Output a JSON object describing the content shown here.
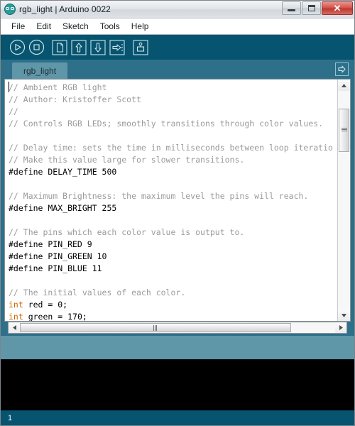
{
  "window": {
    "title": "rgb_light | Arduino 0022",
    "app_icon": "arduino-infinity-icon",
    "controls": {
      "minimize": "minimize-button",
      "maximize": "maximize-button",
      "close_glyph": "✕"
    }
  },
  "menubar": {
    "items": [
      {
        "label": "File"
      },
      {
        "label": "Edit"
      },
      {
        "label": "Sketch"
      },
      {
        "label": "Tools"
      },
      {
        "label": "Help"
      }
    ]
  },
  "toolbar": {
    "buttons": [
      {
        "name": "verify-button",
        "icon": "play-icon",
        "title": "Verify"
      },
      {
        "name": "stop-button",
        "icon": "stop-icon",
        "title": "Stop"
      },
      {
        "name": "new-button",
        "icon": "new-file-icon",
        "title": "New"
      },
      {
        "name": "open-button",
        "icon": "up-arrow-icon",
        "title": "Open"
      },
      {
        "name": "save-button",
        "icon": "down-arrow-icon",
        "title": "Save"
      },
      {
        "name": "upload-button",
        "icon": "right-arrow-icon",
        "title": "Upload"
      },
      {
        "name": "serial-monitor-button",
        "icon": "serial-monitor-icon",
        "title": "Serial Monitor"
      }
    ]
  },
  "tabs": {
    "active": "rgb_light",
    "items": [
      {
        "label": "rgb_light"
      }
    ],
    "menu_icon": "tab-menu-arrow-icon"
  },
  "editor": {
    "lines": [
      {
        "segments": [
          {
            "t": "// Ambient RGB light",
            "c": "cm"
          }
        ]
      },
      {
        "segments": [
          {
            "t": "// Author: Kristoffer Scott",
            "c": "cm"
          }
        ]
      },
      {
        "segments": [
          {
            "t": "//",
            "c": "cm"
          }
        ]
      },
      {
        "segments": [
          {
            "t": "// Controls RGB LEDs; smoothly transitions through color values.",
            "c": "cm"
          }
        ]
      },
      {
        "segments": [
          {
            "t": "",
            "c": ""
          }
        ]
      },
      {
        "segments": [
          {
            "t": "// Delay time: sets the time in milliseconds between loop iteratio",
            "c": "cm"
          }
        ]
      },
      {
        "segments": [
          {
            "t": "// Make this value large for slower transitions.",
            "c": "cm"
          }
        ]
      },
      {
        "segments": [
          {
            "t": "#define DELAY_TIME 500",
            "c": ""
          }
        ]
      },
      {
        "segments": [
          {
            "t": "",
            "c": ""
          }
        ]
      },
      {
        "segments": [
          {
            "t": "// Maximum Brightness: the maximum level the pins will reach.",
            "c": "cm"
          }
        ]
      },
      {
        "segments": [
          {
            "t": "#define MAX_BRIGHT 255",
            "c": ""
          }
        ]
      },
      {
        "segments": [
          {
            "t": "",
            "c": ""
          }
        ]
      },
      {
        "segments": [
          {
            "t": "// The pins which each color value is output to.",
            "c": "cm"
          }
        ]
      },
      {
        "segments": [
          {
            "t": "#define PIN_RED 9",
            "c": ""
          }
        ]
      },
      {
        "segments": [
          {
            "t": "#define PIN_GREEN 10",
            "c": ""
          }
        ]
      },
      {
        "segments": [
          {
            "t": "#define PIN_BLUE 11",
            "c": ""
          }
        ]
      },
      {
        "segments": [
          {
            "t": "",
            "c": ""
          }
        ]
      },
      {
        "segments": [
          {
            "t": "// The initial values of each color.",
            "c": "cm"
          }
        ]
      },
      {
        "segments": [
          {
            "t": "int",
            "c": "kw"
          },
          {
            "t": " red = 0;",
            "c": ""
          }
        ]
      },
      {
        "segments": [
          {
            "t": "int",
            "c": "kw"
          },
          {
            "t": " green = 170;",
            "c": ""
          }
        ]
      }
    ]
  },
  "scrollbars": {
    "vertical": {
      "up_glyph": "▲",
      "down_glyph": "▼",
      "thumb_position_pct": 8,
      "thumb_size_pct": 20
    },
    "horizontal": {
      "left_glyph": "◄",
      "right_glyph": "►",
      "thumb_position_pct": 0,
      "thumb_size_pct": 86
    }
  },
  "console": {
    "text": ""
  },
  "statusbar": {
    "message": ""
  },
  "bottombar": {
    "line_number": "1"
  },
  "colors": {
    "toolbar_bg": "#06546f",
    "tabstrip_bg": "#2e708a",
    "tab_active_bg": "#5f96a8",
    "editor_bg": "#ffffff",
    "comment": "#9a9a9a",
    "keyword": "#cc6600",
    "console_bg": "#000000",
    "close_button": "#c9493e"
  }
}
